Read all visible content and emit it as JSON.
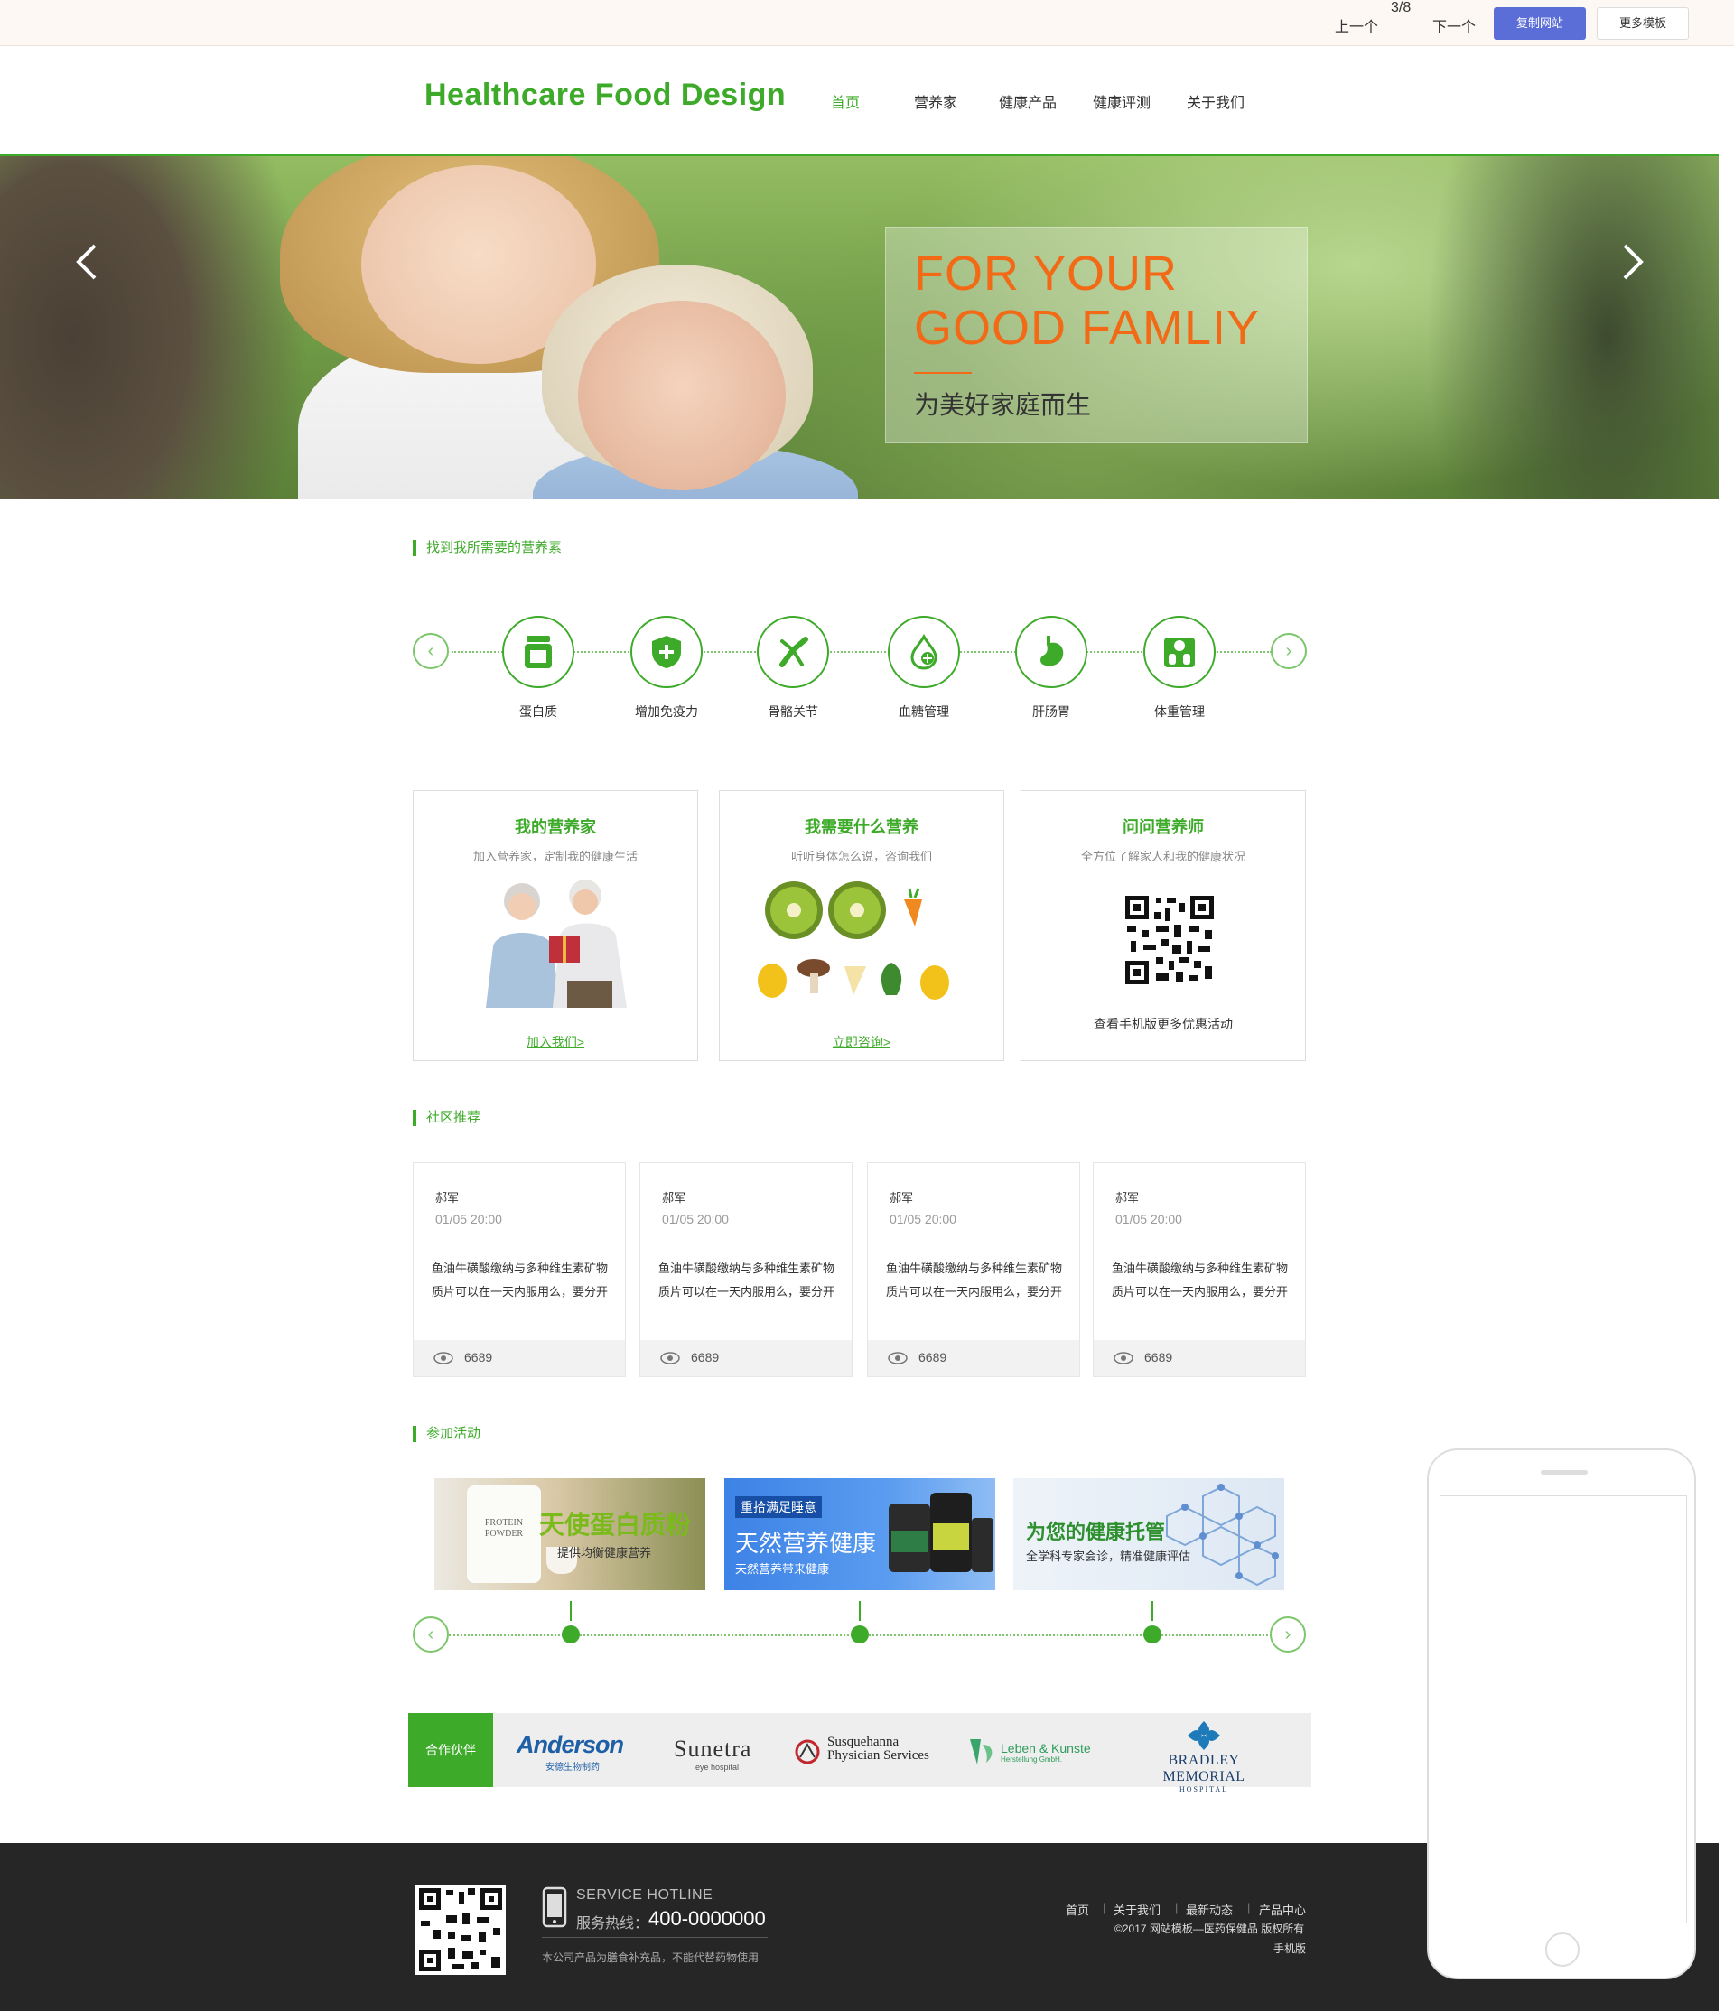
{
  "topbar": {
    "prev": "上一个",
    "page_current": "3",
    "page_total": "/8",
    "next": "下一个",
    "copy_button": "复制网站",
    "more_button": "更多模板"
  },
  "header": {
    "logo": "Healthcare Food Design",
    "nav": [
      "首页",
      "营养家",
      "健康产品",
      "健康评测",
      "关于我们"
    ],
    "active_nav": "首页"
  },
  "banner": {
    "headline_line1": "FOR YOUR",
    "headline_line2": "GOOD FAMLIY",
    "subtitle": "为美好家庭而生",
    "prev_arrow": "chevron-left-icon",
    "next_arrow": "chevron-right-icon"
  },
  "nutrients": {
    "title": "找到我所需要的营养素",
    "items": [
      {
        "label": "蛋白质",
        "icon": "protein-jar-icon"
      },
      {
        "label": "增加免疫力",
        "icon": "shield-plus-icon"
      },
      {
        "label": "骨骼关节",
        "icon": "joint-bone-icon"
      },
      {
        "label": "血糖管理",
        "icon": "blood-drop-icon"
      },
      {
        "label": "肝肠胃",
        "icon": "stomach-icon"
      },
      {
        "label": "体重管理",
        "icon": "scale-icon"
      }
    ]
  },
  "features": [
    {
      "title": "我的营养家",
      "subtitle": "加入营养家，定制我的健康生活",
      "link": "加入我们>"
    },
    {
      "title": "我需要什么营养",
      "subtitle": "听听身体怎么说，咨询我们",
      "link": "立即咨询>"
    },
    {
      "title": "问问营养师",
      "subtitle": "全方位了解家人和我的健康状况",
      "footer": "查看手机版更多优惠活动"
    }
  ],
  "community": {
    "title": "社区推荐",
    "posts": [
      {
        "author": "郝军",
        "time": "01/05 20:00",
        "body": "鱼油牛磺酸缴纳与多种维生素矿物质片可以在一天内服用么，要分开",
        "views": "6689"
      },
      {
        "author": "郝军",
        "time": "01/05 20:00",
        "body": "鱼油牛磺酸缴纳与多种维生素矿物质片可以在一天内服用么，要分开",
        "views": "6689"
      },
      {
        "author": "郝军",
        "time": "01/05 20:00",
        "body": "鱼油牛磺酸缴纳与多种维生素矿物质片可以在一天内服用么，要分开",
        "views": "6689"
      },
      {
        "author": "郝军",
        "time": "01/05 20:00",
        "body": "鱼油牛磺酸缴纳与多种维生素矿物质片可以在一天内服用么，要分开",
        "views": "6689"
      }
    ]
  },
  "activities": {
    "title": "参加活动",
    "items": [
      {
        "title": "天使蛋白质粉",
        "subtitle": "提供均衡健康营养",
        "jar_label1": "PROTEIN",
        "jar_label2": "POWDER"
      },
      {
        "tag": "重拾满足睡意",
        "title": "天然营养健康",
        "subtitle": "天然营养带来健康"
      },
      {
        "title": "为您的健康托管",
        "subtitle": "全学科专家会诊，精准健康评估"
      }
    ]
  },
  "partners": {
    "label": "合作伙伴",
    "logos": [
      {
        "name": "Anderson",
        "sub": "安德生物制药"
      },
      {
        "name": "Sunetra",
        "sub": "eye hospital"
      },
      {
        "name": "Susquehanna",
        "sub": "Physician Services"
      },
      {
        "name": "Leben & Kunste",
        "sub": "Herstellung GmbH."
      },
      {
        "name": "Bradley Memorial",
        "sub": "HOSPITAL"
      }
    ]
  },
  "footer": {
    "hotline_en": "SERVICE HOTLINE",
    "hotline_cn": "服务热线：",
    "hotline_number": "400-0000000",
    "note": "本公司产品为膳食补充品，不能代替药物使用",
    "links": [
      "首页",
      "关于我们",
      "最新动态",
      "产品中心"
    ],
    "copyright": "©2017 网站模板—医药保健品 版权所有",
    "mobile": "手机版"
  },
  "colors": {
    "brand_green": "#3daa2a",
    "banner_orange": "#f26a16",
    "copy_button_blue": "#5b6ed8",
    "footer_bg": "#262626"
  }
}
